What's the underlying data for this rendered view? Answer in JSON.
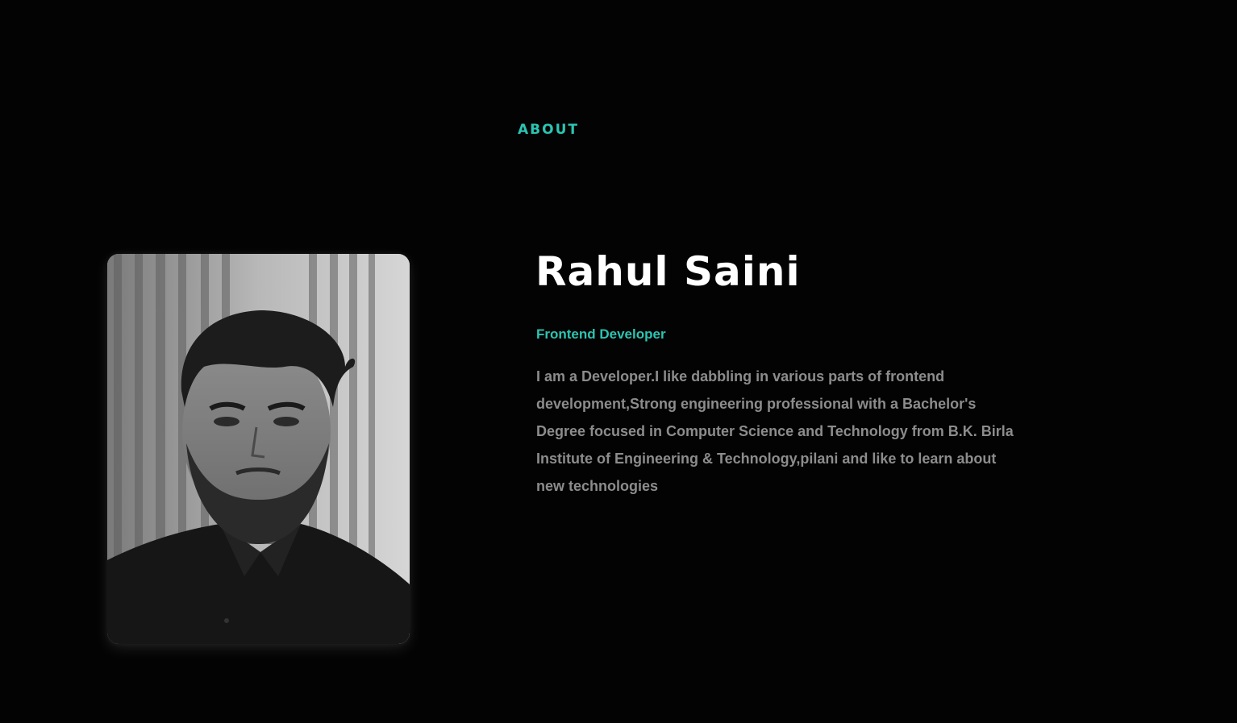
{
  "about": {
    "section_label": "ABOUT",
    "name": "Rahul Saini",
    "role": "Frontend Developer",
    "bio": "I am a Developer.I like dabbling in various parts of frontend development,Strong engineering professional with a Bachelor's Degree focused in Computer Science and Technology from B.K. Birla Institute of Engineering & Technology,pilani and like to learn about new technologies"
  },
  "colors": {
    "background": "#030303",
    "accent": "#2cc4b2",
    "heading": "#ffffff",
    "body_text": "#8c8c8c"
  },
  "media": {
    "portrait": "profile-photo-grayscale"
  }
}
